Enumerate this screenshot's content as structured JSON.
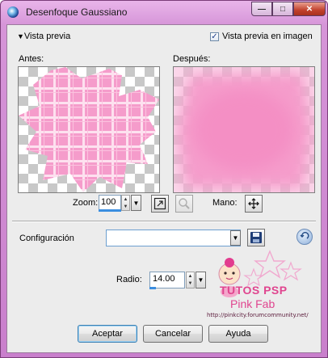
{
  "window": {
    "title": "Desenfoque Gaussiano"
  },
  "preview": {
    "toggle_label": "Vista previa",
    "image_checkbox_label": "Vista previa en imagen",
    "image_checkbox_checked": true,
    "before_label": "Antes:",
    "after_label": "Después:"
  },
  "zoom": {
    "label": "Zoom:",
    "value": "100",
    "pan_label": "Mano:"
  },
  "config": {
    "label": "Configuración",
    "value": ""
  },
  "radius": {
    "label": "Radio:",
    "value": "14.00"
  },
  "watermark": {
    "line1": "TUTOS PSP",
    "line2": "Pink Fab",
    "url": "http://pinkcity.forumcommunity.net/"
  },
  "buttons": {
    "ok": "Aceptar",
    "cancel": "Cancelar",
    "help": "Ayuda"
  },
  "colors": {
    "accent": "#3b8ee0",
    "pink": "#f29bcc",
    "frame": "#d695d8"
  }
}
